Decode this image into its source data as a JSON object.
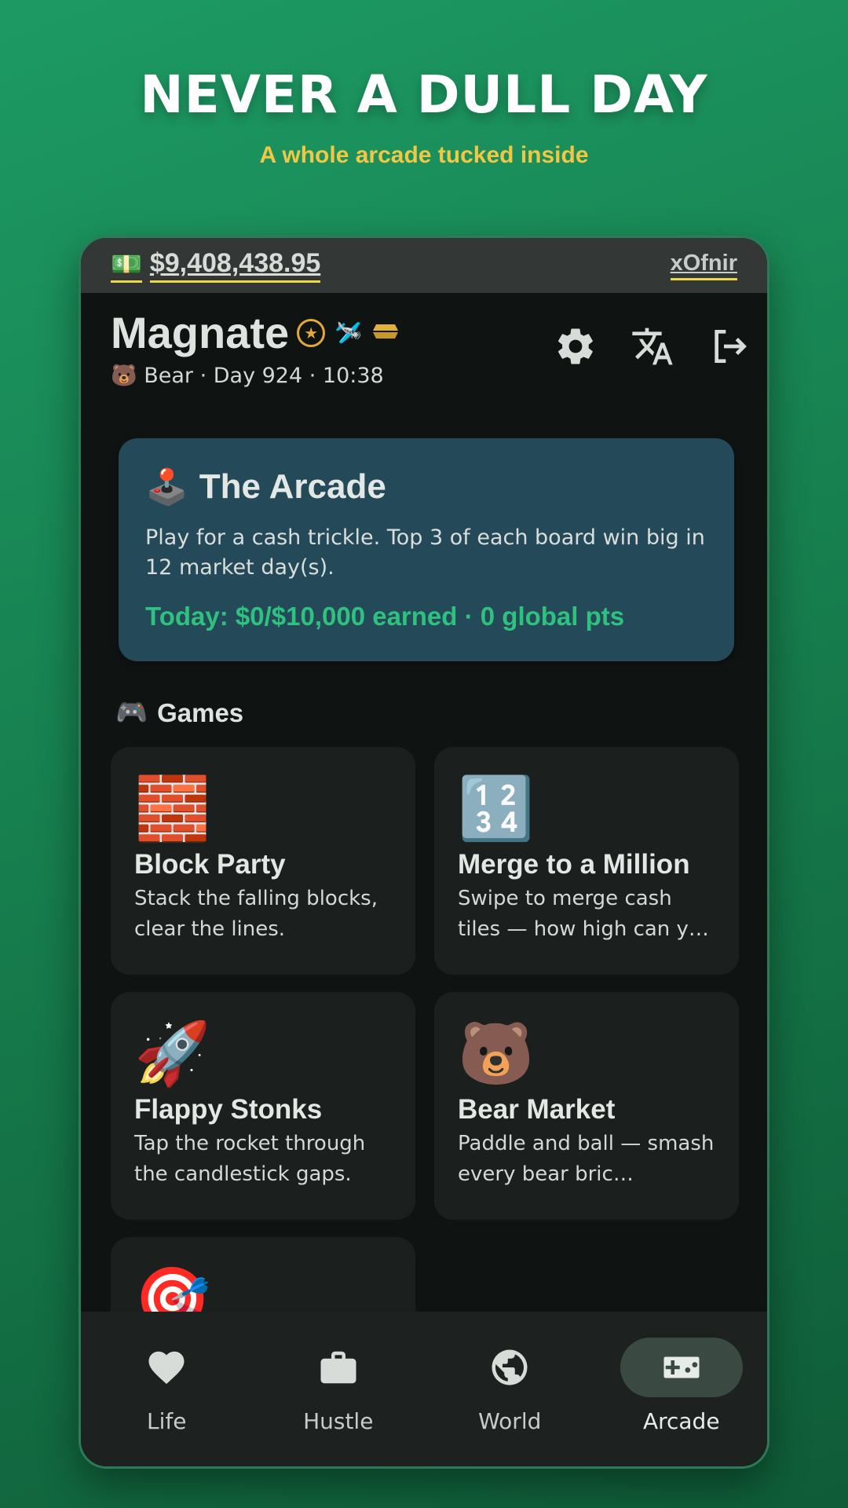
{
  "hero": {
    "title": "NEVER A DULL DAY",
    "subtitle": "A whole arcade tucked inside"
  },
  "topbar": {
    "cash_icon": "💵",
    "cash": "$9,408,438.95",
    "username": "xOfnir"
  },
  "header": {
    "title": "Magnate",
    "badges": [
      "star-badge",
      "plane-badge",
      "gold-bar-badge"
    ],
    "badge_plane": "🛩️",
    "badge_gold": "🪙",
    "star": "★",
    "status": "🐻 Bear · Day 924 · 10:38",
    "actions": [
      "settings-icon",
      "translate-icon",
      "logout-icon"
    ]
  },
  "arcade": {
    "icon": "🕹️",
    "title": "The Arcade",
    "description": "Play for a cash trickle. Top 3 of each board win big in 12 market day(s).",
    "today": "Today: $0/$10,000 earned · 0 global pts"
  },
  "games_section": {
    "icon": "🎮",
    "label": "Games"
  },
  "games": [
    {
      "emoji": "🧱",
      "name": "Block Party",
      "desc": "Stack the falling blocks, clear the lines."
    },
    {
      "emoji": "🔢",
      "name": "Merge to a Million",
      "desc": "Swipe to merge cash tiles — how high can y…"
    },
    {
      "emoji": "🚀",
      "name": "Flappy Stonks",
      "desc": "Tap the rocket through the candlestick gaps."
    },
    {
      "emoji": "🐻",
      "name": "Bear Market",
      "desc": "Paddle and ball — smash every bear bric…"
    },
    {
      "emoji": "🎯",
      "name": "",
      "desc": ""
    }
  ],
  "nav": {
    "items": [
      {
        "label": "Life",
        "icon": "heart-icon"
      },
      {
        "label": "Hustle",
        "icon": "briefcase-icon"
      },
      {
        "label": "World",
        "icon": "globe-icon"
      },
      {
        "label": "Arcade",
        "icon": "gamepad-icon"
      }
    ],
    "active": "Arcade"
  },
  "colors": {
    "background": "#1d9a64",
    "accent_yellow": "#f2c744",
    "accent_green": "#2fc27e",
    "card_blue": "#244a59"
  }
}
